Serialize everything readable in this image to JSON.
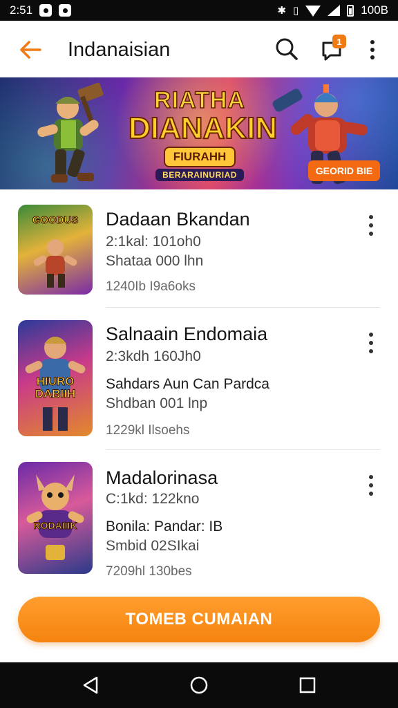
{
  "status_bar": {
    "time": "2:51",
    "battery_text": "100B",
    "icons": [
      "app-notification-icon",
      "app-notification-icon",
      "bluetooth-icon",
      "vibrate-icon",
      "wifi-icon",
      "signal-icon",
      "battery-icon"
    ]
  },
  "app_bar": {
    "title": "Indanaisian",
    "notification_count": "1",
    "accent_color": "#f07a14",
    "icons": [
      "back-arrow-icon",
      "search-icon",
      "chat-notification-icon",
      "more-vertical-icon"
    ]
  },
  "banner": {
    "headline_top": "RIATHA",
    "headline_main": "DIANAKIN",
    "badge": "FIURAHH",
    "sub_badge": "BERARAINURIAD",
    "cta_label": "GEORID BIE"
  },
  "games": [
    {
      "thumb_label": "GOODUS",
      "title": "Dadaan Bkandan",
      "line1": "2:1kal: 101oh0",
      "line2": "",
      "line3": "Shataa 000 lhn",
      "footer": "1240Ib I9a6oks"
    },
    {
      "thumb_label": "HIURO DABIIH",
      "title": "Salnaain Endomaia",
      "line1": "2:3kdh 160Jh0",
      "line2": "Sahdars Aun Can Pardca",
      "line3": "Shdban 001 lnp",
      "footer": "1229kl Ilsoehs"
    },
    {
      "thumb_label": "RODAIIIK",
      "title": "Madalorinasa",
      "line1": "C:1kd: 122kno",
      "line2": "Bonila:  Pandar: IB",
      "line3": "Smbid 02SIkai",
      "footer": "7209hl 130bes"
    }
  ],
  "cta": {
    "label": "TOMEB CUMAIAN",
    "color": "#f5840f"
  },
  "nav_bar": {
    "icons": [
      "back-triangle-icon",
      "home-circle-icon",
      "recents-square-icon"
    ]
  }
}
